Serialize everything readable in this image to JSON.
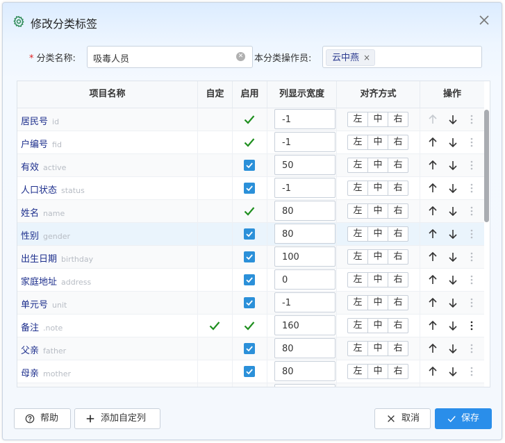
{
  "dialog": {
    "title": "修改分类标签",
    "close_icon": "close-icon",
    "settings_icon": "gear-icon"
  },
  "form": {
    "required_mark": "*",
    "name_label": "分类名称:",
    "name_value": "吸毒人员",
    "operator_label": "本分类操作员:",
    "operator_tag": "云中燕",
    "operator_tag_remove": "×"
  },
  "grid": {
    "headers": [
      "项目名称",
      "自定",
      "启用",
      "列显示宽度",
      "对齐方式",
      "操作"
    ],
    "align_labels": [
      "左",
      "中",
      "右"
    ],
    "rows": [
      {
        "name": "居民号",
        "field": "id",
        "custom": false,
        "enabled": "check",
        "width": "-1",
        "selected": false,
        "more": false
      },
      {
        "name": "户编号",
        "field": "fid",
        "custom": false,
        "enabled": "check",
        "width": "-1",
        "selected": false,
        "more": false
      },
      {
        "name": "有效",
        "field": "active",
        "custom": false,
        "enabled": "box",
        "width": "50",
        "selected": false,
        "more": false
      },
      {
        "name": "人口状态",
        "field": "status",
        "custom": false,
        "enabled": "box",
        "width": "-1",
        "selected": false,
        "more": false
      },
      {
        "name": "姓名",
        "field": "name",
        "custom": false,
        "enabled": "check",
        "width": "80",
        "selected": false,
        "more": false
      },
      {
        "name": "性别",
        "field": "gender",
        "custom": false,
        "enabled": "box",
        "width": "80",
        "selected": true,
        "more": false
      },
      {
        "name": "出生日期",
        "field": "birthday",
        "custom": false,
        "enabled": "box",
        "width": "100",
        "selected": false,
        "more": false
      },
      {
        "name": "家庭地址",
        "field": "address",
        "custom": false,
        "enabled": "box",
        "width": "0",
        "selected": false,
        "more": false
      },
      {
        "name": "单元号",
        "field": "unit",
        "custom": false,
        "enabled": "box",
        "width": "-1",
        "selected": false,
        "more": false
      },
      {
        "name": "备注",
        "field": ".note",
        "custom": true,
        "enabled": "check",
        "width": "160",
        "selected": false,
        "more": true
      },
      {
        "name": "父亲",
        "field": "father",
        "custom": false,
        "enabled": "box",
        "width": "80",
        "selected": false,
        "more": false
      },
      {
        "name": "母亲",
        "field": "mother",
        "custom": false,
        "enabled": "box",
        "width": "80",
        "selected": false,
        "more": false
      },
      {
        "name": "",
        "field": "",
        "custom": false,
        "enabled": "none",
        "width": "",
        "selected": false,
        "more": false
      }
    ]
  },
  "footer": {
    "help_label": "帮助",
    "add_column_label": "添加自定列",
    "cancel_label": "取消",
    "save_label": "保存"
  },
  "colors": {
    "accent": "#2a8eea",
    "checkbox": "#2b90d9",
    "checkmark": "#1f8f1f",
    "link_text": "#1c2e8c",
    "selected_row": "#eaf4fc"
  }
}
